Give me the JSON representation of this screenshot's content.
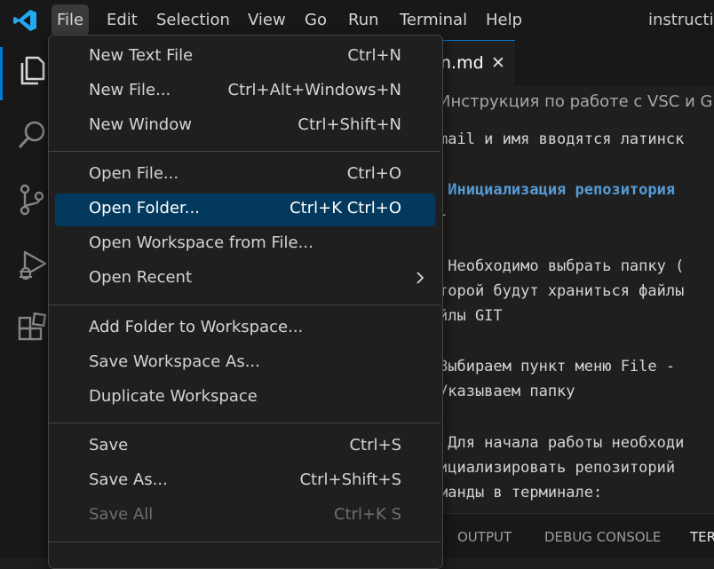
{
  "menubar": {
    "items": [
      "File",
      "Edit",
      "Selection",
      "View",
      "Go",
      "Run",
      "Terminal",
      "Help"
    ],
    "active": "File",
    "window_title": "instructio"
  },
  "activity_bar": {
    "icons": [
      "files-icon",
      "search-icon",
      "source-control-icon",
      "run-debug-icon",
      "extensions-icon"
    ]
  },
  "editor": {
    "tab_label": "n.md",
    "tab_close": "✕",
    "breadcrumb": "Инструкция по работе с VSC и GIT",
    "lines": [
      "mail и имя вводятся латинск",
      " Инициализация репозитория",
      "-",
      " Необходимо выбрать папку (",
      "торой будут храниться файлы",
      "йлы GIT",
      "Выбираем пункт меню File -",
      "Указываем папку",
      " Для начала работы необходи",
      "ициализировать репозиторий",
      "манды в терминале:"
    ]
  },
  "panel": {
    "tabs": [
      "OUTPUT",
      "DEBUG CONSOLE",
      "TER"
    ],
    "active": "TER"
  },
  "file_menu": {
    "groups": [
      [
        {
          "label": "New Text File",
          "shortcut": "Ctrl+N"
        },
        {
          "label": "New File...",
          "shortcut": "Ctrl+Alt+Windows+N"
        },
        {
          "label": "New Window",
          "shortcut": "Ctrl+Shift+N"
        }
      ],
      [
        {
          "label": "Open File...",
          "shortcut": "Ctrl+O"
        },
        {
          "label": "Open Folder...",
          "shortcut": "Ctrl+K Ctrl+O",
          "highlighted": true
        },
        {
          "label": "Open Workspace from File...",
          "shortcut": ""
        },
        {
          "label": "Open Recent",
          "shortcut": "",
          "submenu": true
        }
      ],
      [
        {
          "label": "Add Folder to Workspace...",
          "shortcut": ""
        },
        {
          "label": "Save Workspace As...",
          "shortcut": ""
        },
        {
          "label": "Duplicate Workspace",
          "shortcut": ""
        }
      ],
      [
        {
          "label": "Save",
          "shortcut": "Ctrl+S"
        },
        {
          "label": "Save As...",
          "shortcut": "Ctrl+Shift+S"
        },
        {
          "label": "Save All",
          "shortcut": "Ctrl+K S",
          "disabled": true
        }
      ]
    ]
  },
  "colors": {
    "accent": "#0078d4",
    "highlight": "#04395e",
    "heading_text": "#569cd6",
    "logo": "#23a9f2"
  }
}
